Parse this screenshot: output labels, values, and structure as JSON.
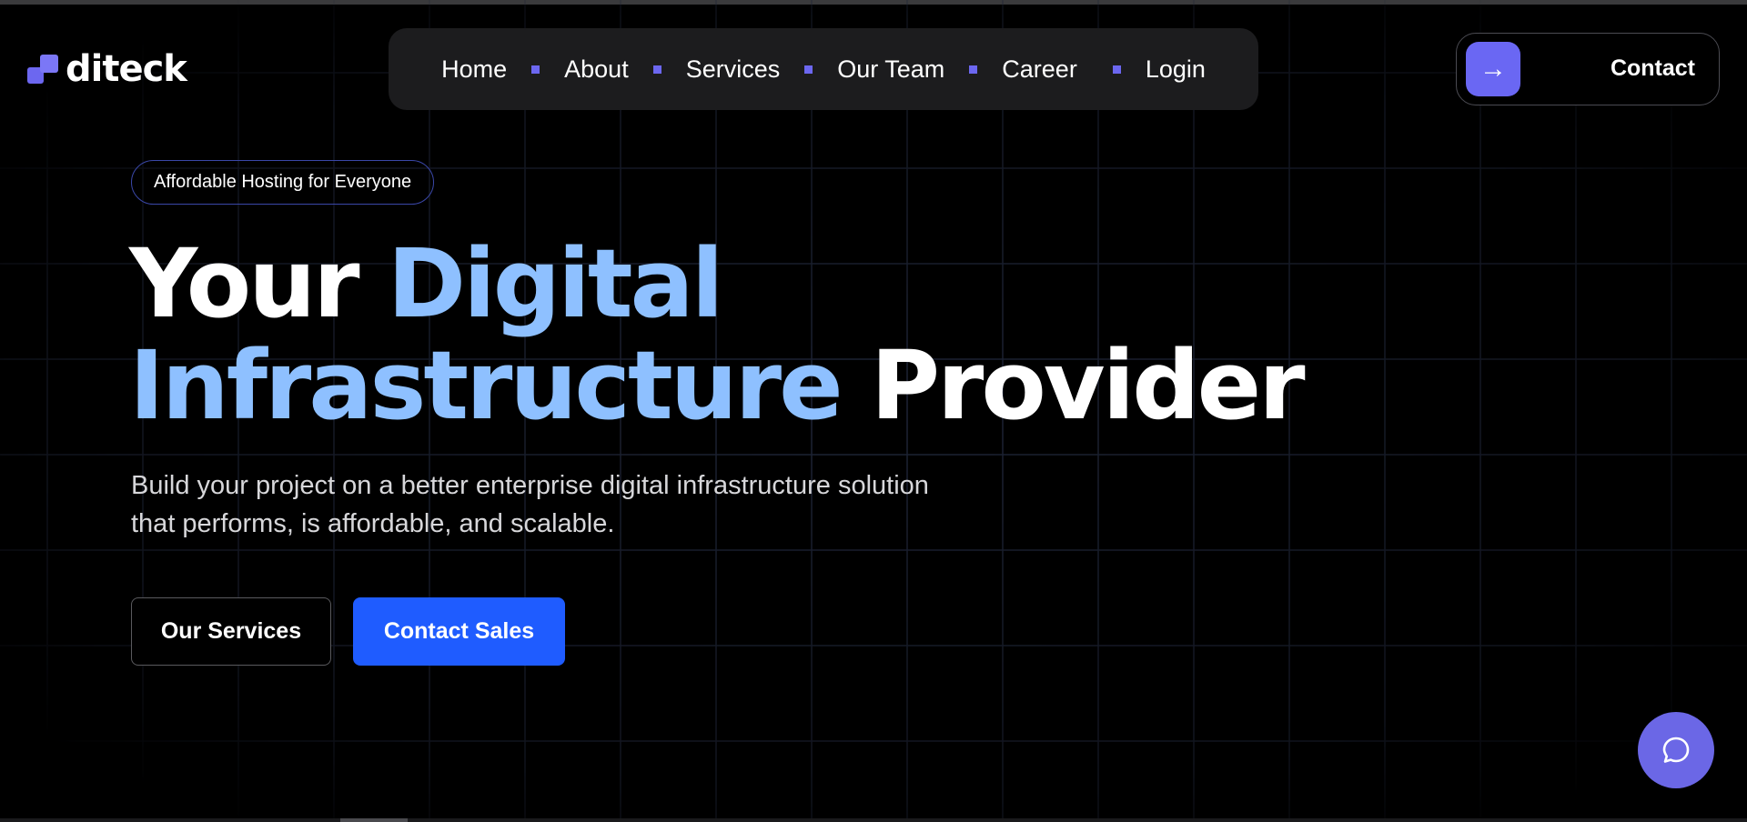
{
  "brand": {
    "name": "diteck",
    "accent_color": "#6c67f0"
  },
  "nav": {
    "items": [
      {
        "label": "Home"
      },
      {
        "label": "About"
      },
      {
        "label": "Services"
      },
      {
        "label": "Our Team"
      },
      {
        "label": "Career"
      },
      {
        "label": "Login"
      }
    ]
  },
  "header": {
    "contact_label": "Contact",
    "contact_arrow_glyph": "→",
    "contact_icon": "arrow-right-icon"
  },
  "hero": {
    "badge": "Affordable Hosting for Everyone",
    "headline": {
      "part1": "Your ",
      "part2": "Digital",
      "part3": "Infrastructure",
      "part4": " Provider"
    },
    "headline_highlight_color": "#8ec0ff",
    "subtitle_line1": "Build your project on a better enterprise digital infrastructure solution",
    "subtitle_line2": "that performs, is affordable, and scalable.",
    "buttons": {
      "services": "Our Services",
      "sales": "Contact Sales"
    },
    "primary_button_color": "#1f5cff"
  },
  "chat": {
    "icon": "chat-bubble-icon",
    "color": "#6b67e6"
  }
}
